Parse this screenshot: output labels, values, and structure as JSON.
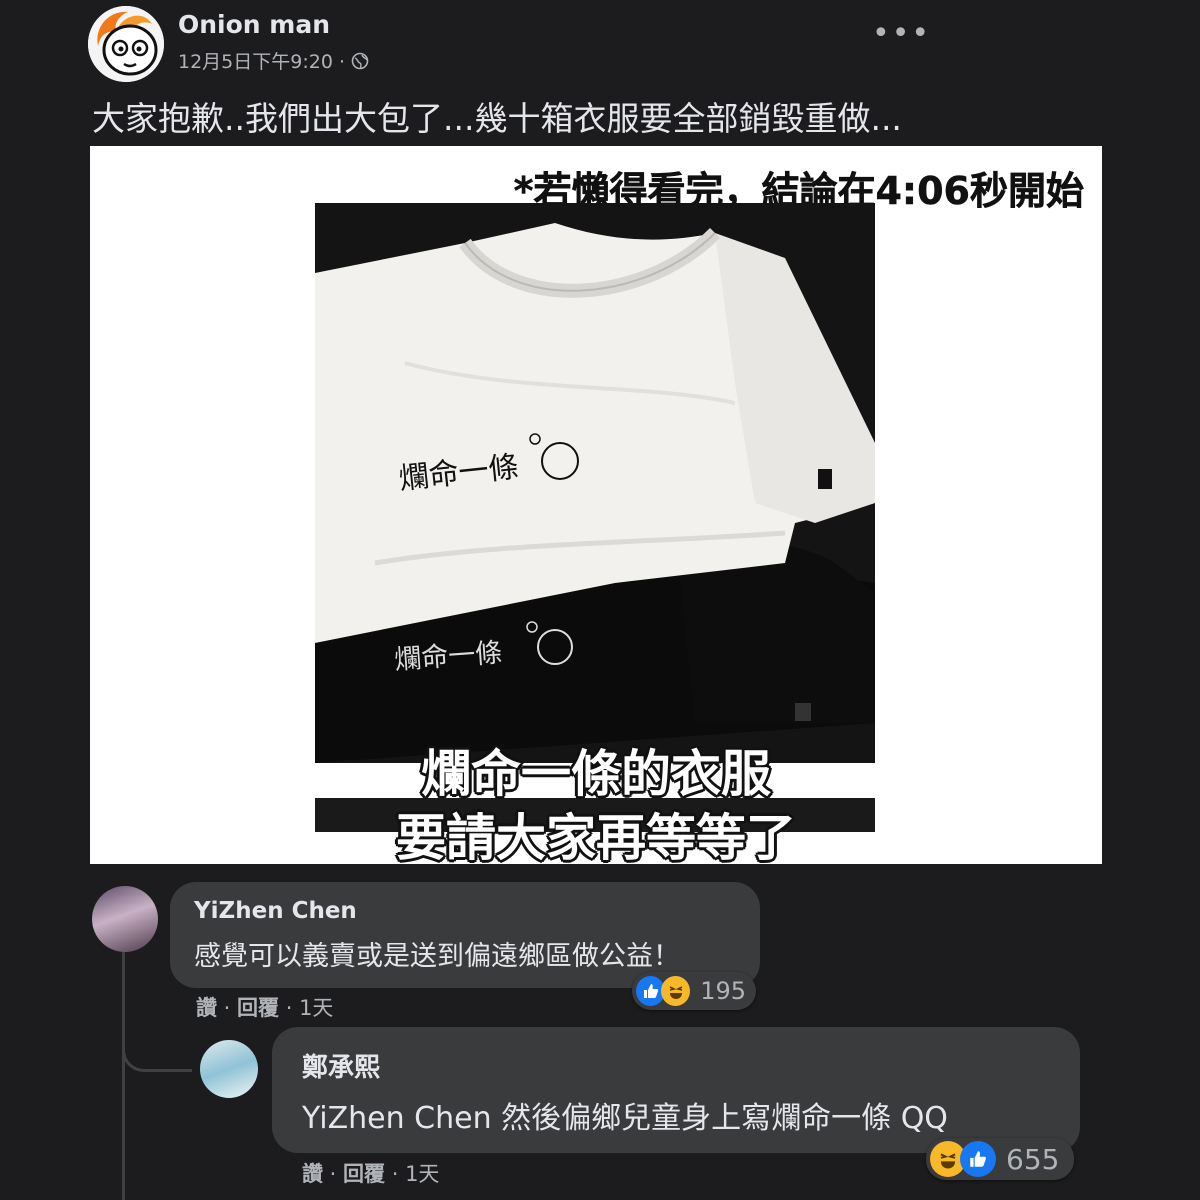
{
  "post": {
    "author": "Onion man",
    "timestamp": "12月5日下午9:20 ·",
    "privacy_icon": "globe-icon",
    "more_label": "•••",
    "text": "大家抱歉..我們出大包了...幾十箱衣服要全部銷毀重做..."
  },
  "image": {
    "top_caption": "*若懶得看完，結論在4:06秒開始",
    "shirt_print_white": "爛命一條",
    "shirt_print_black": "爛命一條",
    "overlay_line1": "爛命一條的衣服",
    "overlay_line2": "要請大家再等等了"
  },
  "comments": [
    {
      "name": "YiZhen Chen",
      "text": "感覺可以義賣或是送到偏遠鄉區做公益！",
      "actions": {
        "like": "讚",
        "reply": "回覆",
        "age": "1天"
      },
      "reactions": {
        "icons": [
          "like-icon",
          "haha-icon"
        ],
        "count": "195"
      }
    },
    {
      "name": "鄭承熙",
      "mention": "YiZhen Chen",
      "text": "然後偏鄉兒童身上寫爛命一條 QQ",
      "actions": {
        "like": "讚",
        "reply": "回覆",
        "age": "1天"
      },
      "reactions": {
        "icons": [
          "haha-icon",
          "like-icon"
        ],
        "count": "655"
      }
    }
  ],
  "colors": {
    "background": "#1c1c1e",
    "bubble": "#3a3b3c",
    "primary_text": "#e4e6eb",
    "secondary_text": "#b0b3b8",
    "like_blue": "#1877f2",
    "haha_yellow": "#f7b928"
  }
}
